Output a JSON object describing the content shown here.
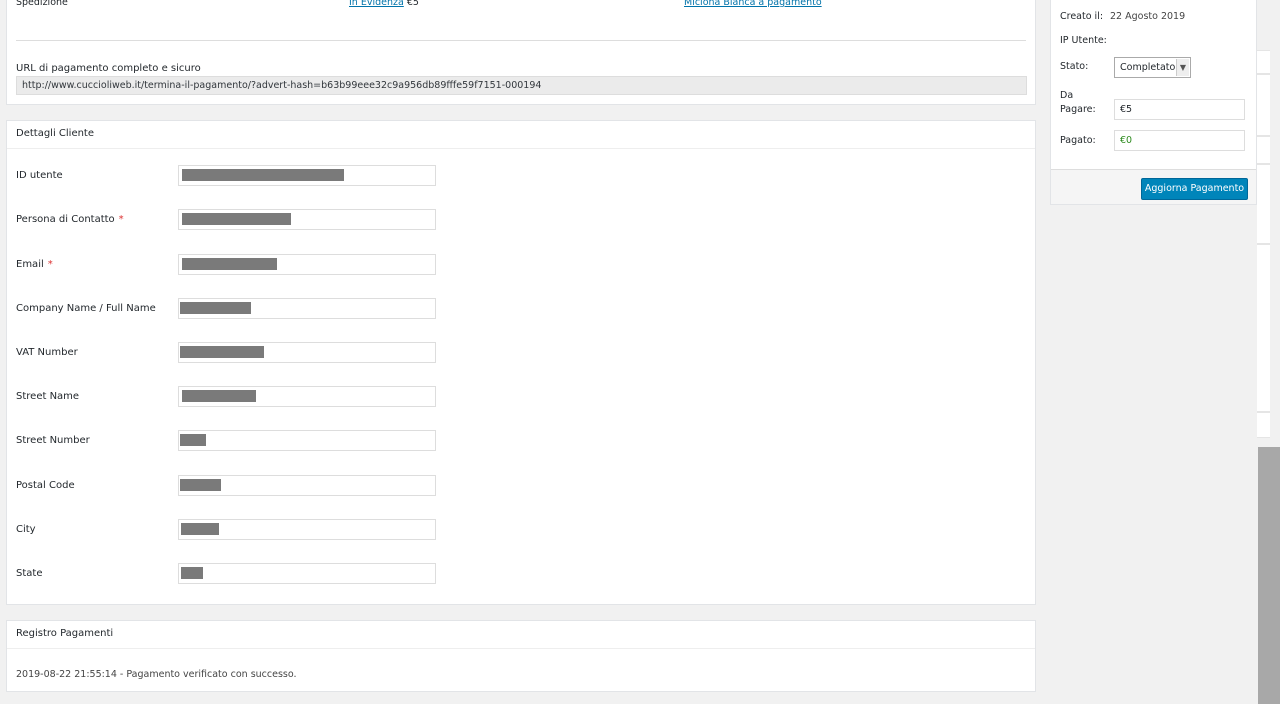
{
  "top": {
    "shipping_label": "Spedizione",
    "featured_link": "In Evidenza",
    "featured_price": "€5",
    "white_bone_link": "Miciona Bianca a pagamento",
    "url_label": "URL di pagamento completo e sicuro",
    "url_value": "http://www.cuccioliweb.it/termina-il-pagamento/?advert-hash=b63b99eee32c9a956db89fffe59f7151-000194"
  },
  "customer": {
    "title": "Dettagli Cliente",
    "fields": [
      {
        "label": "ID utente",
        "required": false
      },
      {
        "label": "Persona di Contatto",
        "required": true
      },
      {
        "label": "Email",
        "required": true
      },
      {
        "label": "Company Name / Full Name",
        "required": false
      },
      {
        "label": "VAT Number",
        "required": false
      },
      {
        "label": "Street Name",
        "required": false
      },
      {
        "label": "Street Number",
        "required": false
      },
      {
        "label": "Postal Code",
        "required": false
      },
      {
        "label": "City",
        "required": false
      },
      {
        "label": "State",
        "required": false
      }
    ],
    "required_mark": "*"
  },
  "log": {
    "title": "Registro Pagamenti",
    "entry": "2019-08-22 21:55:14 - Pagamento verificato con successo."
  },
  "side": {
    "created_label": "Creato il:",
    "created_value": "22 Agosto 2019",
    "ip_label": "IP Utente:",
    "status_label": "Stato:",
    "status_value": "Completato",
    "due_label_1": "Da",
    "due_label_2": "Pagare:",
    "due_value": "€5",
    "paid_label": "Pagato:",
    "paid_value": "€0",
    "update_button": "Aggiorna Pagamento"
  },
  "colors": {
    "accent": "#0085ba",
    "required": "#dc3232",
    "paid": "#2e8b1f"
  }
}
